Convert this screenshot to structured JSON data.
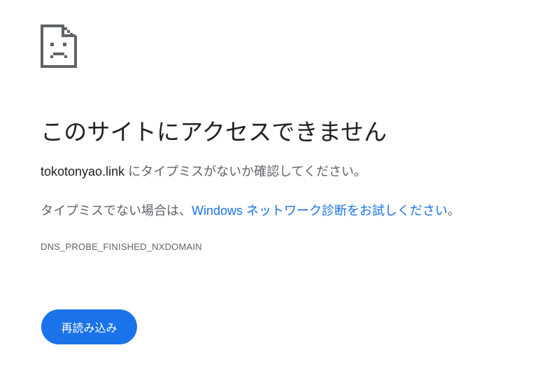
{
  "icon": "sad-document-icon",
  "title": "このサイトにアクセスできません",
  "message": {
    "domain": "tokotonyao.link",
    "suffix": " にタイプミスがないか確認してください。"
  },
  "suggestion": {
    "prefix": "タイプミスでない場合は、",
    "link_text": "Windows ネットワーク診断をお試しください",
    "suffix": "。"
  },
  "error_code": "DNS_PROBE_FINISHED_NXDOMAIN",
  "reload_button": "再読み込み",
  "colors": {
    "accent": "#1a73e8",
    "text_primary": "#202124",
    "text_secondary": "#5f6368"
  }
}
